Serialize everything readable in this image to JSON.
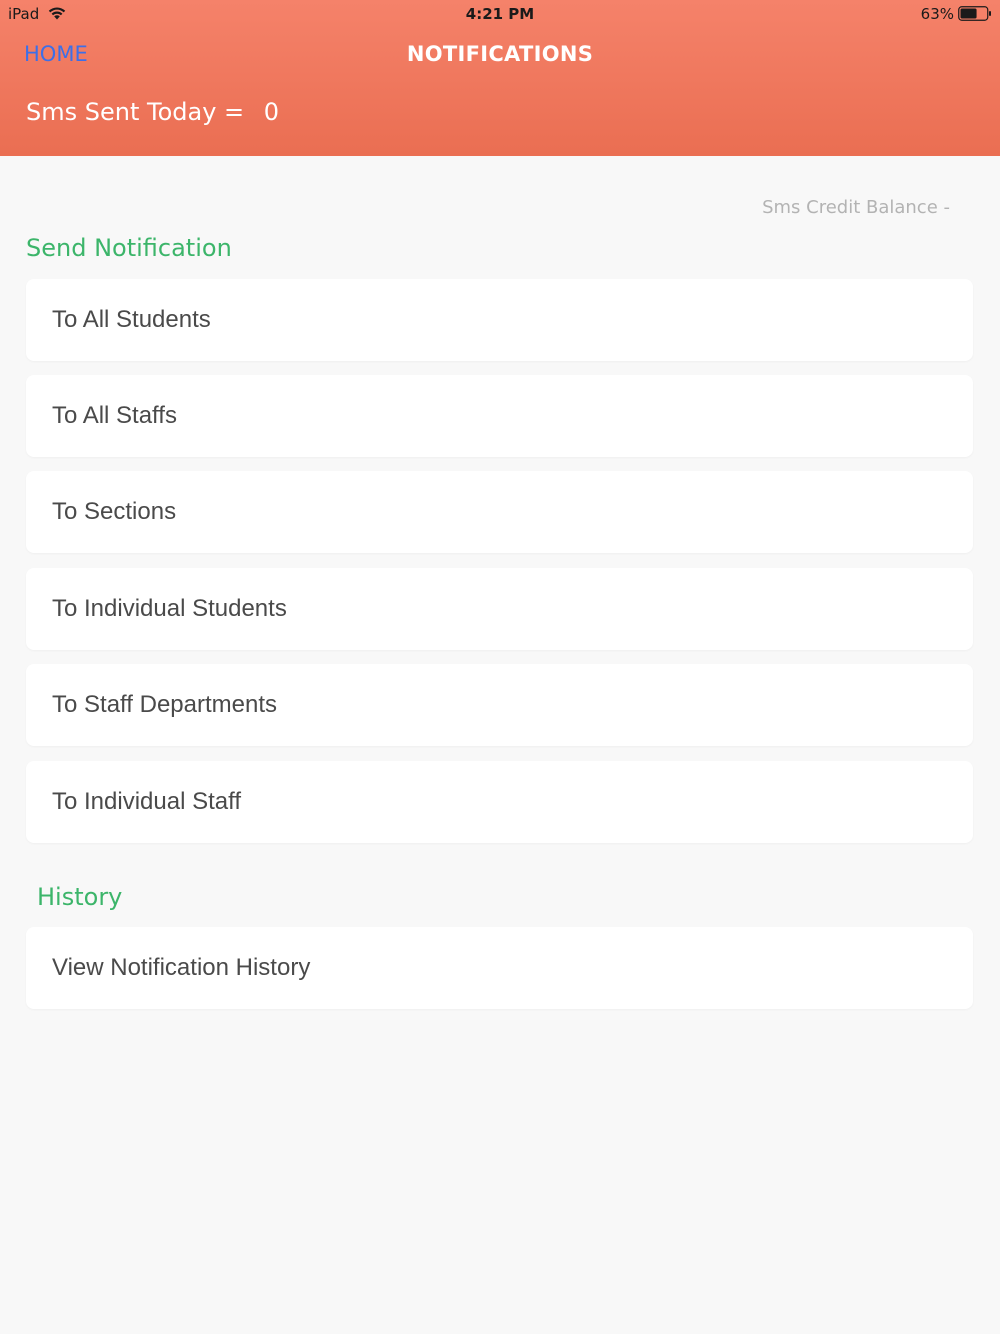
{
  "status_bar": {
    "device": "iPad",
    "time": "4:21 PM",
    "battery": "63%",
    "battery_level": 0.63,
    "wifi_icon": "wifi-icon",
    "battery_icon": "battery-icon"
  },
  "nav": {
    "back_label": "HOME",
    "title": "NOTIFICATIONS"
  },
  "summary": {
    "sms_sent_label": "Sms Sent Today =",
    "sms_sent_value": "0",
    "credit_balance_label": "Sms Credit Balance -"
  },
  "send_section": {
    "title": "Send Notification",
    "items": [
      {
        "label": "To All Students"
      },
      {
        "label": "To All Staffs"
      },
      {
        "label": "To Sections"
      },
      {
        "label": "To Individual Students"
      },
      {
        "label": "To Staff Departments"
      },
      {
        "label": "To Individual Staff"
      }
    ]
  },
  "history_section": {
    "title": "History",
    "items": [
      {
        "label": "View Notification History"
      }
    ]
  },
  "colors": {
    "header_top": "#f5826a",
    "header_bottom": "#ea6e52",
    "link_blue": "#3d6fe8",
    "section_green": "#3cb56a",
    "background": "#f8f8f8"
  }
}
